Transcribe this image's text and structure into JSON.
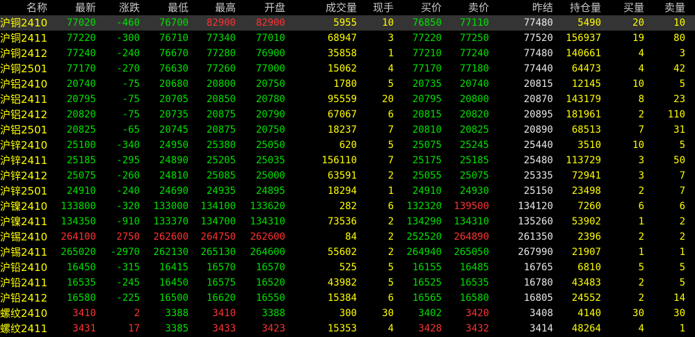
{
  "columns": [
    {
      "key": "name",
      "label": "名称"
    },
    {
      "key": "latest",
      "label": "最新"
    },
    {
      "key": "change",
      "label": "涨跌"
    },
    {
      "key": "low",
      "label": "最低"
    },
    {
      "key": "high",
      "label": "最高"
    },
    {
      "key": "open",
      "label": "开盘"
    },
    {
      "key": "volume",
      "label": "成交量"
    },
    {
      "key": "cur",
      "label": "现手"
    },
    {
      "key": "bid",
      "label": "买价"
    },
    {
      "key": "ask",
      "label": "卖价"
    },
    {
      "key": "prev",
      "label": "昨结"
    },
    {
      "key": "oi",
      "label": "持仓量"
    },
    {
      "key": "bidvol",
      "label": "买量"
    },
    {
      "key": "askvol",
      "label": "卖量"
    }
  ],
  "selected_row": 0,
  "colors": {
    "up": "#ff3232",
    "down": "#00e000",
    "yellow": "#ffff00",
    "white": "#e8e8e8",
    "header": "#c8c8c8",
    "selected": "#343434"
  },
  "rows": [
    {
      "name": "沪铜2410",
      "latest": "77020",
      "change": "-460",
      "low": "76700",
      "high": "82900",
      "open": "82900",
      "volume": "5955",
      "cur": "10",
      "bid": "76850",
      "ask": "77110",
      "prev": "77480",
      "oi": "5490",
      "bidvol": "20",
      "askvol": "10"
    },
    {
      "name": "沪铜2411",
      "latest": "77220",
      "change": "-300",
      "low": "76710",
      "high": "77340",
      "open": "77010",
      "volume": "68947",
      "cur": "3",
      "bid": "77220",
      "ask": "77250",
      "prev": "77520",
      "oi": "156937",
      "bidvol": "19",
      "askvol": "80"
    },
    {
      "name": "沪铜2412",
      "latest": "77240",
      "change": "-240",
      "low": "76670",
      "high": "77280",
      "open": "76900",
      "volume": "35858",
      "cur": "1",
      "bid": "77210",
      "ask": "77240",
      "prev": "77480",
      "oi": "140661",
      "bidvol": "4",
      "askvol": "3"
    },
    {
      "name": "沪铜2501",
      "latest": "77170",
      "change": "-270",
      "low": "76630",
      "high": "77260",
      "open": "77000",
      "volume": "15062",
      "cur": "4",
      "bid": "77170",
      "ask": "77180",
      "prev": "77440",
      "oi": "64473",
      "bidvol": "4",
      "askvol": "42"
    },
    {
      "name": "沪铝2410",
      "latest": "20740",
      "change": "-75",
      "low": "20680",
      "high": "20800",
      "open": "20750",
      "volume": "1780",
      "cur": "5",
      "bid": "20735",
      "ask": "20740",
      "prev": "20815",
      "oi": "12145",
      "bidvol": "10",
      "askvol": "5"
    },
    {
      "name": "沪铝2411",
      "latest": "20795",
      "change": "-75",
      "low": "20705",
      "high": "20850",
      "open": "20780",
      "volume": "95559",
      "cur": "20",
      "bid": "20795",
      "ask": "20800",
      "prev": "20870",
      "oi": "143179",
      "bidvol": "8",
      "askvol": "23"
    },
    {
      "name": "沪铝2412",
      "latest": "20820",
      "change": "-75",
      "low": "20735",
      "high": "20875",
      "open": "20790",
      "volume": "67067",
      "cur": "6",
      "bid": "20815",
      "ask": "20820",
      "prev": "20895",
      "oi": "181961",
      "bidvol": "2",
      "askvol": "110"
    },
    {
      "name": "沪铝2501",
      "latest": "20825",
      "change": "-65",
      "low": "20745",
      "high": "20875",
      "open": "20750",
      "volume": "18237",
      "cur": "7",
      "bid": "20810",
      "ask": "20825",
      "prev": "20890",
      "oi": "68513",
      "bidvol": "7",
      "askvol": "31"
    },
    {
      "name": "沪锌2410",
      "latest": "25100",
      "change": "-340",
      "low": "24950",
      "high": "25380",
      "open": "25050",
      "volume": "620",
      "cur": "5",
      "bid": "25075",
      "ask": "25245",
      "prev": "25440",
      "oi": "3510",
      "bidvol": "10",
      "askvol": "5"
    },
    {
      "name": "沪锌2411",
      "latest": "25185",
      "change": "-295",
      "low": "24890",
      "high": "25205",
      "open": "25035",
      "volume": "156110",
      "cur": "7",
      "bid": "25175",
      "ask": "25185",
      "prev": "25480",
      "oi": "113729",
      "bidvol": "3",
      "askvol": "50"
    },
    {
      "name": "沪锌2412",
      "latest": "25075",
      "change": "-260",
      "low": "24810",
      "high": "25085",
      "open": "25000",
      "volume": "63591",
      "cur": "2",
      "bid": "25055",
      "ask": "25075",
      "prev": "25335",
      "oi": "72941",
      "bidvol": "3",
      "askvol": "7"
    },
    {
      "name": "沪锌2501",
      "latest": "24910",
      "change": "-240",
      "low": "24690",
      "high": "24935",
      "open": "24895",
      "volume": "18294",
      "cur": "1",
      "bid": "24910",
      "ask": "24930",
      "prev": "25150",
      "oi": "23498",
      "bidvol": "2",
      "askvol": "7"
    },
    {
      "name": "沪镍2410",
      "latest": "133800",
      "change": "-320",
      "low": "133000",
      "high": "134100",
      "open": "133620",
      "volume": "282",
      "cur": "6",
      "bid": "132320",
      "ask": "139500",
      "prev": "134120",
      "oi": "7260",
      "bidvol": "6",
      "askvol": "6"
    },
    {
      "name": "沪镍2411",
      "latest": "134350",
      "change": "-910",
      "low": "133370",
      "high": "134700",
      "open": "134310",
      "volume": "73536",
      "cur": "2",
      "bid": "134290",
      "ask": "134310",
      "prev": "135260",
      "oi": "53902",
      "bidvol": "1",
      "askvol": "2"
    },
    {
      "name": "沪锡2410",
      "latest": "264100",
      "change": "2750",
      "low": "262600",
      "high": "264750",
      "open": "262600",
      "volume": "84",
      "cur": "2",
      "bid": "252520",
      "ask": "264890",
      "prev": "261350",
      "oi": "2396",
      "bidvol": "2",
      "askvol": "2"
    },
    {
      "name": "沪锡2411",
      "latest": "265020",
      "change": "-2970",
      "low": "262130",
      "high": "265130",
      "open": "264600",
      "volume": "55602",
      "cur": "2",
      "bid": "264940",
      "ask": "265050",
      "prev": "267990",
      "oi": "21907",
      "bidvol": "1",
      "askvol": "1"
    },
    {
      "name": "沪铅2410",
      "latest": "16450",
      "change": "-315",
      "low": "16415",
      "high": "16570",
      "open": "16570",
      "volume": "525",
      "cur": "5",
      "bid": "16155",
      "ask": "16485",
      "prev": "16765",
      "oi": "6810",
      "bidvol": "5",
      "askvol": "5"
    },
    {
      "name": "沪铅2411",
      "latest": "16535",
      "change": "-245",
      "low": "16450",
      "high": "16575",
      "open": "16520",
      "volume": "43982",
      "cur": "5",
      "bid": "16525",
      "ask": "16535",
      "prev": "16780",
      "oi": "43483",
      "bidvol": "2",
      "askvol": "5"
    },
    {
      "name": "沪铅2412",
      "latest": "16580",
      "change": "-225",
      "low": "16500",
      "high": "16620",
      "open": "16550",
      "volume": "15384",
      "cur": "6",
      "bid": "16565",
      "ask": "16580",
      "prev": "16805",
      "oi": "24552",
      "bidvol": "2",
      "askvol": "14"
    },
    {
      "name": "螺纹2410",
      "latest": "3410",
      "change": "2",
      "low": "3388",
      "high": "3410",
      "open": "3388",
      "volume": "300",
      "cur": "30",
      "bid": "3402",
      "ask": "3420",
      "prev": "3408",
      "oi": "4140",
      "bidvol": "30",
      "askvol": "30"
    },
    {
      "name": "螺纹2411",
      "latest": "3431",
      "change": "17",
      "low": "3385",
      "high": "3433",
      "open": "3423",
      "volume": "15353",
      "cur": "4",
      "bid": "3428",
      "ask": "3432",
      "prev": "3414",
      "oi": "48264",
      "bidvol": "4",
      "askvol": "1"
    }
  ]
}
